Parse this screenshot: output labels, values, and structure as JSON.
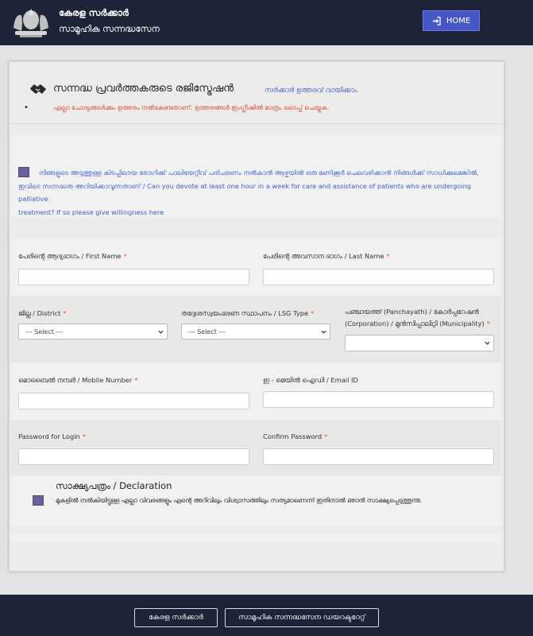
{
  "header": {
    "gov_name": "കേരള സർക്കാർ",
    "dept_name": "സാമൂഹിക സന്നദ്ധസേന",
    "home_label": "HOME"
  },
  "registration": {
    "title": "സന്നദ്ധ പ്രവർത്തകരുടെ രജിസ്ട്രേഷൻ",
    "order_link": "സർക്കാർ ഉത്തരവ് വായിക്കാം",
    "bullet": "•",
    "instruction": "എല്ലാ ചോദ്യങ്ങൾക്കും ഉത്തരം നൽകേണ്ടതാണ്. ഉത്തരങ്ങൾ ഇംഗ്ലീഷിൽ മാത്രം ടൈപ്പ് ചെയ്യുക."
  },
  "willingness": {
    "text_line1": "നിങ്ങളുടെ അടുത്തുള്ള കിടപ്പിലായ രോഗിക്ക് പാലിയേറ്റീവ് പരിചരണം നൽകാൻ ആഴ്ചയിൽ ഒരു മണിക്കൂർ ചെലവഴിക്കാൻ നിങ്ങൾക്ക് സാധിക്കുമെങ്കിൽ,",
    "text_line2": "ഇവിടെ സന്നദ്ധത അറിയിക്കാവുന്നതാണ് / Can you devote at least one hour in a week for care and assistance of patients who are undergoing palliative",
    "text_line3": "treatment? If so please give willingness here"
  },
  "form": {
    "first_name_label": "പേരിന്റെ ആദ്യഭാഗം / First Name",
    "last_name_label": "പേരിന്റെ അവസാന ഭാഗം / Last Name",
    "district_label": "ജില്ല / District",
    "district_value": "--- Select ---",
    "lsg_type_label": "തദ്ദേശസ്വയംഭരണ സ്ഥാപനം / LSG Type",
    "lsg_type_value": "--- Select ---",
    "panchayath_label_1": "പഞ്ചായത്ത് (Panchayath) / കോർപ്പറേഷൻ",
    "panchayath_label_2": "(Corporation) / മുൻസിപ്പാലിറ്റി (Municipality)",
    "panchayath_value": "",
    "mobile_label": "മൊബൈൽ നമ്പർ / Mobile Number",
    "email_label": "ഇ - മെയിൽ ഐഡി / Email ID",
    "password_label": "Password for Login",
    "confirm_password_label": "Confirm Password",
    "required_mark": "*"
  },
  "declaration": {
    "title": "സാക്ഷ്യപത്രം / Declaration",
    "text": "മുകളിൽ നൽകിയിട്ടുള്ള എല്ലാ വിവരങ്ങളും എന്റെ അറിവിലും വിശ്വാസത്തിലും സത്യമാണെന്ന് ഇതിനാൽ ഞാൻ സാക്ഷ്യപ്പെടുത്തുന്നു."
  },
  "footer": {
    "btn_gov": "കേരള സർക്കാർ",
    "btn_directorate": "സാമൂഹിക സന്നദ്ധസേന ഡയറക്ടറേറ്റ്"
  },
  "colors": {
    "navbar": "#1e2437",
    "home_button": "#4656c6",
    "link": "#3e63c7",
    "instruction": "#d84a3f",
    "checkbox": "#6b5f9a",
    "required": "#d9534f"
  },
  "icons": {
    "emblem": "kerala-emblem-icon",
    "home": "sign-in-arrow-icon",
    "title": "handshake-icon",
    "select": "chevron-down-icon"
  }
}
